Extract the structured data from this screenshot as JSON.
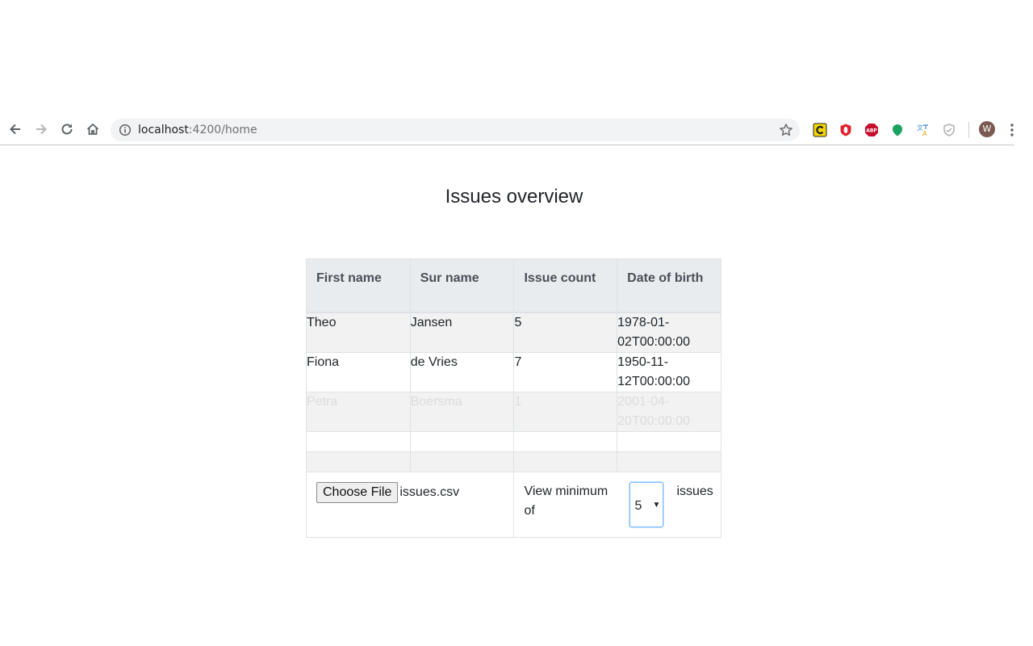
{
  "browser": {
    "url_host": "localhost",
    "url_path": ":4200/home",
    "avatar_initial": "W",
    "extensions": [
      {
        "name": "c-extension-icon",
        "color": "#f2d600"
      },
      {
        "name": "opera-red-icon",
        "color": "#e0242c"
      },
      {
        "name": "adblock-icon",
        "color": "#c70d2c",
        "label": "ABP"
      },
      {
        "name": "green-balloon-icon",
        "color": "#1aa260"
      },
      {
        "name": "translate-icon",
        "color": "#3b8bd8"
      },
      {
        "name": "shield-icon",
        "color": "#b0b0b0"
      }
    ]
  },
  "page": {
    "title": "Issues overview"
  },
  "table": {
    "headers": [
      "First name",
      "Sur name",
      "Issue count",
      "Date of birth"
    ],
    "rows": [
      [
        "Theo",
        "Jansen",
        "5",
        "1978-01-02T00:00:00"
      ],
      [
        "Fiona",
        "de Vries",
        "7",
        "1950-11-12T00:00:00"
      ],
      [
        "Petra",
        "Boersma",
        "1",
        "2001-04-20T00:00:00"
      ]
    ],
    "footer": {
      "choose_file_label": "Choose File",
      "file_name": "issues.csv",
      "filter_prefix": "View minimum of",
      "filter_value": "5",
      "filter_suffix": "issues"
    }
  }
}
